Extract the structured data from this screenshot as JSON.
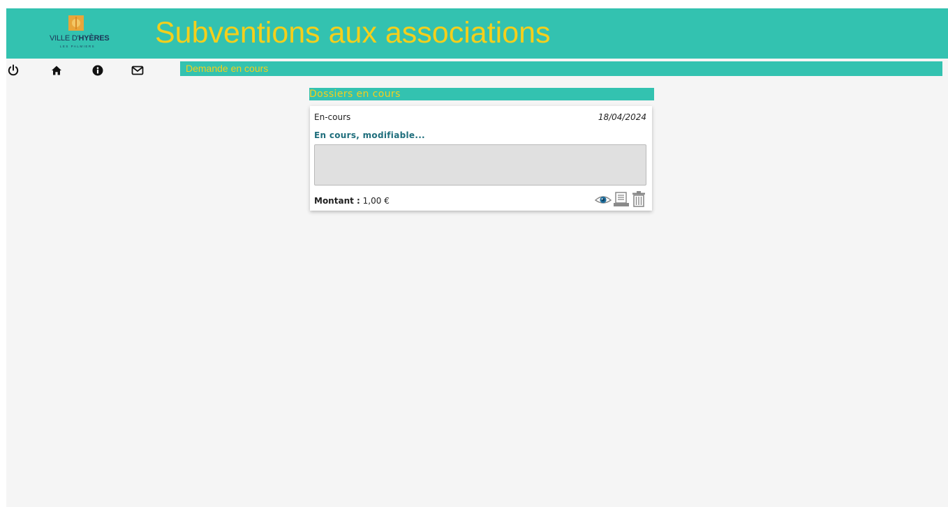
{
  "header": {
    "title": "Subventions aux associations",
    "logo": {
      "line1_a": "VILLE D'",
      "line1_b": "HYÈRES",
      "line2": "LES PALMIERS"
    }
  },
  "toolbar": {
    "icons": [
      "power-icon",
      "home-icon",
      "info-icon",
      "mail-icon"
    ]
  },
  "breadcrumb": {
    "current": "Demande en cours"
  },
  "section": {
    "title": "Dossiers en cours"
  },
  "dossiers": [
    {
      "status": "En-cours",
      "date": "18/04/2024",
      "subtitle": "En cours, modifiable...",
      "note": "",
      "amount_label": "Montant :",
      "amount_value": "1,00 €",
      "actions": [
        "view-icon",
        "edit-document-icon",
        "delete-icon"
      ]
    }
  ],
  "colors": {
    "brand_teal": "#33c2b0",
    "title_yellow": "#f5cf1b",
    "subtitle_blue": "#1f6e7c",
    "page_background": "#f5f5f5"
  }
}
